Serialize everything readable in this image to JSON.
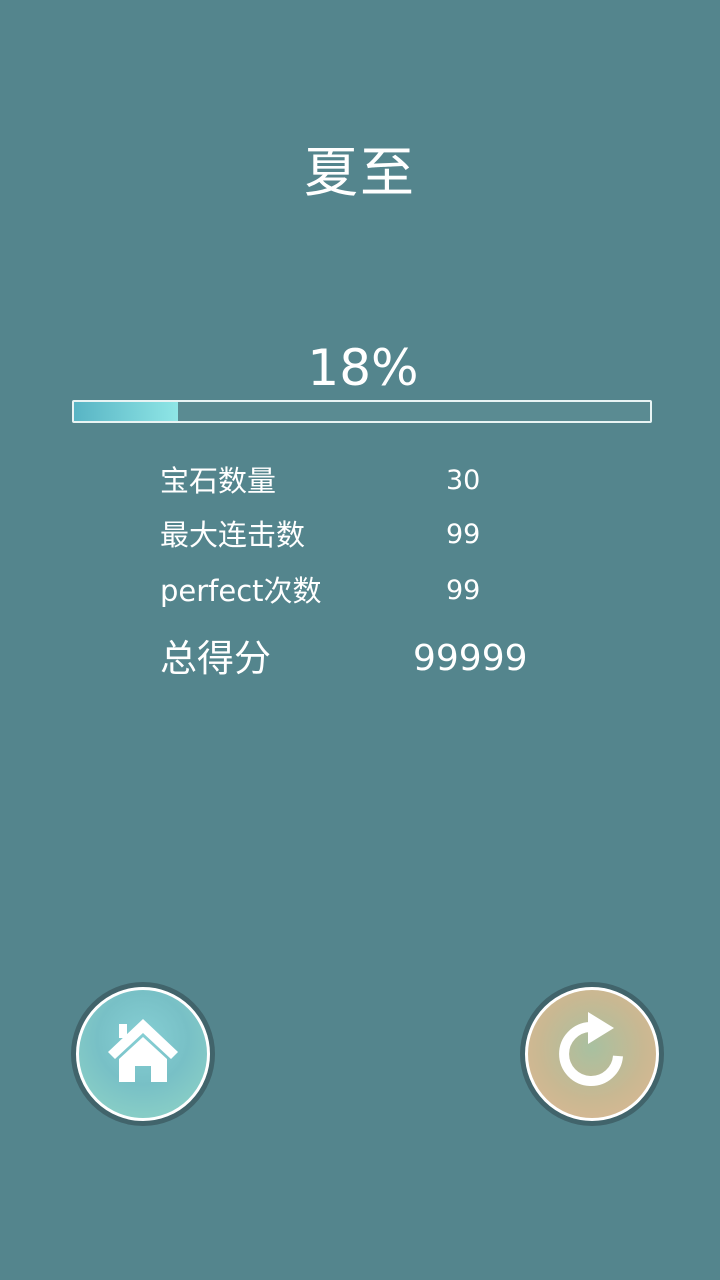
{
  "level": {
    "title": "夏至"
  },
  "progress": {
    "label": "18%",
    "value": 0.18
  },
  "stats": [
    {
      "label": "宝石数量",
      "value": "30"
    },
    {
      "label": "最大连击数",
      "value": "99"
    },
    {
      "label": "perfect次数",
      "value": "99"
    }
  ],
  "total": {
    "label": "总得分",
    "value": "99999"
  },
  "buttons": {
    "home_icon": "home-icon",
    "restart_icon": "restart-icon"
  },
  "colors": {
    "background": "#54858d",
    "progress_fill": "#8fe6e6",
    "text": "#ffffff"
  }
}
